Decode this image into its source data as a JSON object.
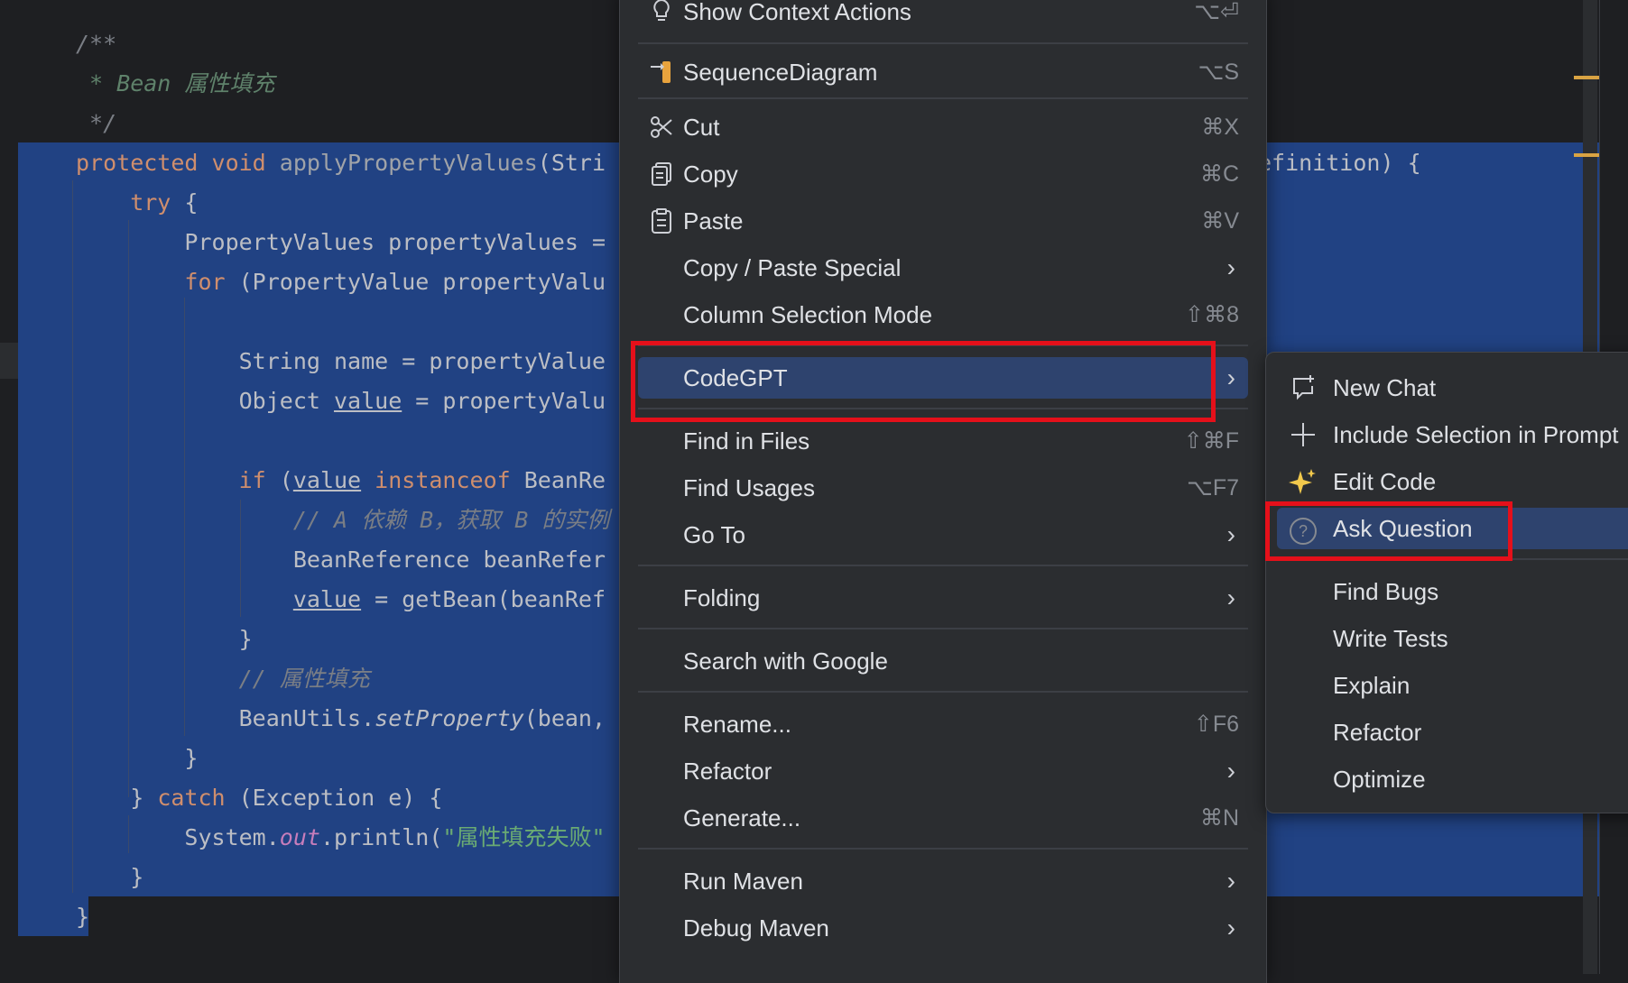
{
  "editor": {
    "lines": [
      {
        "segments": [
          {
            "t": "/**",
            "c": "cm"
          }
        ]
      },
      {
        "segments": [
          {
            "t": " * Bean 属性填充",
            "c": "cmd"
          }
        ]
      },
      {
        "segments": [
          {
            "t": " */",
            "c": "cm"
          }
        ]
      },
      {
        "segments": [
          {
            "t": "protected ",
            "c": "kw"
          },
          {
            "t": "void ",
            "c": "kw"
          },
          {
            "t": "applyPropertyValues",
            "c": "grey"
          },
          {
            "t": "(Stri",
            "c": ""
          }
        ]
      },
      {
        "segments": [
          {
            "t": "    try ",
            "c": "kw"
          },
          {
            "t": "{",
            "c": ""
          }
        ]
      },
      {
        "segments": [
          {
            "t": "        PropertyValues propertyValues =",
            "c": ""
          }
        ]
      },
      {
        "segments": [
          {
            "t": "        for ",
            "c": "kw"
          },
          {
            "t": "(PropertyValue propertyValu",
            "c": ""
          }
        ]
      },
      {
        "segments": [
          {
            "t": "",
            "c": ""
          }
        ]
      },
      {
        "segments": [
          {
            "t": "            String name = propertyValue",
            "c": ""
          }
        ]
      },
      {
        "segments": [
          {
            "t": "            Object ",
            "c": ""
          },
          {
            "t": "value",
            "c": "ul"
          },
          {
            "t": " = propertyValu",
            "c": ""
          }
        ]
      },
      {
        "segments": [
          {
            "t": "",
            "c": ""
          }
        ]
      },
      {
        "segments": [
          {
            "t": "            if ",
            "c": "kw"
          },
          {
            "t": "(",
            "c": ""
          },
          {
            "t": "value",
            "c": "ul"
          },
          {
            "t": " instanceof ",
            "c": "kw"
          },
          {
            "t": "BeanRe",
            "c": ""
          }
        ]
      },
      {
        "segments": [
          {
            "t": "                // A 依赖 B，获取 B 的实例",
            "c": "cm"
          }
        ]
      },
      {
        "segments": [
          {
            "t": "                BeanReference beanRefer",
            "c": ""
          }
        ]
      },
      {
        "segments": [
          {
            "t": "                ",
            "c": ""
          },
          {
            "t": "value",
            "c": "ul"
          },
          {
            "t": " = getBean(beanRef",
            "c": ""
          }
        ]
      },
      {
        "segments": [
          {
            "t": "            }",
            "c": ""
          }
        ]
      },
      {
        "segments": [
          {
            "t": "            // 属性填充",
            "c": "cm"
          }
        ]
      },
      {
        "segments": [
          {
            "t": "            BeanUtils.",
            "c": ""
          },
          {
            "t": "setProperty",
            "c": "itl"
          },
          {
            "t": "(bean,",
            "c": ""
          }
        ]
      },
      {
        "segments": [
          {
            "t": "        }",
            "c": ""
          }
        ]
      },
      {
        "segments": [
          {
            "t": "    } ",
            "c": ""
          },
          {
            "t": "catch ",
            "c": "kw"
          },
          {
            "t": "(Exception e) {",
            "c": ""
          }
        ]
      },
      {
        "segments": [
          {
            "t": "        System.",
            "c": ""
          },
          {
            "t": "out",
            "c": "fld"
          },
          {
            "t": ".println(",
            "c": ""
          },
          {
            "t": "\"属性填充失败\"",
            "c": "str"
          }
        ]
      },
      {
        "segments": [
          {
            "t": "    }",
            "c": ""
          }
        ]
      },
      {
        "segments": [
          {
            "t": "}",
            "c": ""
          }
        ]
      }
    ],
    "right_fragment": "efinition) {"
  },
  "context_menu": {
    "items": [
      {
        "label": "Show Context Actions",
        "shortcut": "⌥⏎",
        "icon": "lightbulb-icon"
      },
      {
        "label": "SequenceDiagram",
        "shortcut": "⌥S",
        "icon": "sequence-diagram-icon"
      },
      {
        "label": "Cut",
        "shortcut": "⌘X",
        "icon": "scissors-icon"
      },
      {
        "label": "Copy",
        "shortcut": "⌘C",
        "icon": "copy-icon"
      },
      {
        "label": "Paste",
        "shortcut": "⌘V",
        "icon": "paste-icon"
      },
      {
        "label": "Copy / Paste Special"
      },
      {
        "label": "Column Selection Mode",
        "shortcut": "⇧⌘8"
      },
      {
        "label": "CodeGPT"
      },
      {
        "label": "Find in Files",
        "shortcut": "⇧⌘F"
      },
      {
        "label": "Find Usages",
        "shortcut": "⌥F7"
      },
      {
        "label": "Go To"
      },
      {
        "label": "Folding"
      },
      {
        "label": "Search with Google"
      },
      {
        "label": "Rename...",
        "shortcut": "⇧F6"
      },
      {
        "label": "Refactor"
      },
      {
        "label": "Generate...",
        "shortcut": "⌘N"
      },
      {
        "label": "Run Maven"
      },
      {
        "label": "Debug Maven"
      }
    ]
  },
  "codegpt_submenu": {
    "items": [
      {
        "label": "New Chat",
        "icon": "new-chat-icon"
      },
      {
        "label": "Include Selection in Prompt",
        "icon": "plus-icon"
      },
      {
        "label": "Edit Code",
        "icon": "sparkle-icon"
      },
      {
        "label": "Ask Question",
        "icon": "question-icon"
      },
      {
        "label": "Find Bugs"
      },
      {
        "label": "Write Tests"
      },
      {
        "label": "Explain"
      },
      {
        "label": "Refactor"
      },
      {
        "label": "Optimize"
      }
    ]
  },
  "colors": {
    "editor_bg": "#1e1f22",
    "selection": "#214283",
    "menu_bg": "#2b2d30",
    "menu_highlight": "#2e436e",
    "annotation_red": "#e5101a"
  }
}
